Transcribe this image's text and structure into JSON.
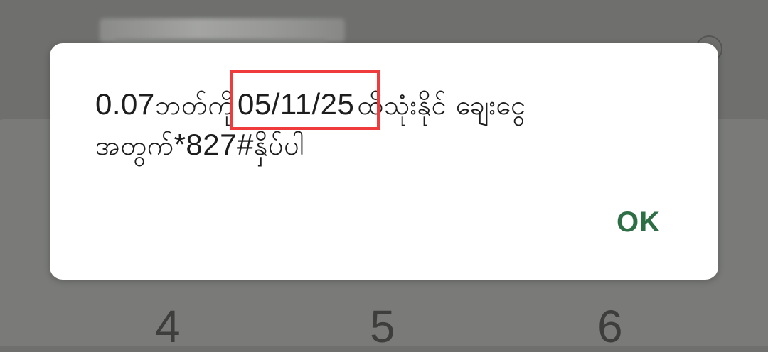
{
  "dialog": {
    "message_line1_prefix_num": "0.07",
    "message_line1_prefix_text": "ဘတ်ကို",
    "message_highlight_date": "05/11/25",
    "message_line1_suffix": "ထိသုံးနိုင် ချေးငွေ",
    "message_line2_text": "အတွက်",
    "message_line2_code": "*827#",
    "message_line2_suffix": "နှိပ်ပါ",
    "ok_label": "OK"
  },
  "background": {
    "numbers": [
      "4",
      "5",
      "6"
    ]
  },
  "colors": {
    "dim_overlay": "#6f706e",
    "dialog_bg": "#ffffff",
    "ok_text": "#2e6e45",
    "highlight_border": "#ef3b3b"
  }
}
